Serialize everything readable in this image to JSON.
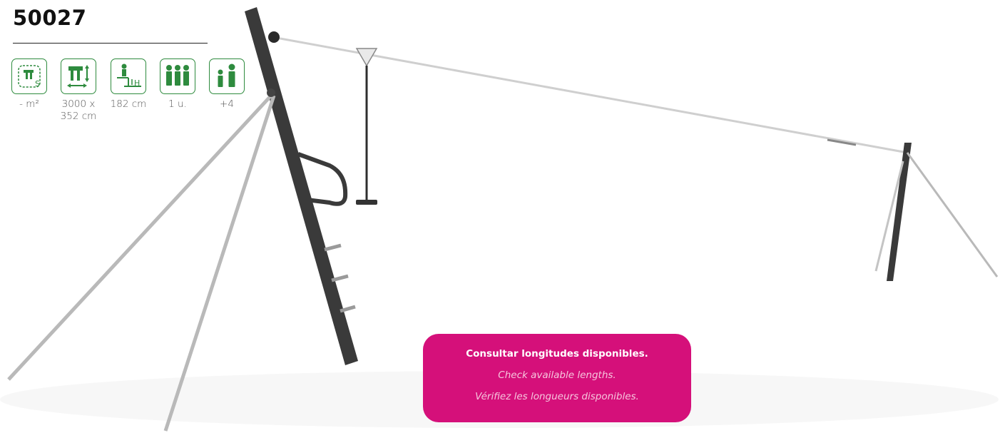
{
  "product": {
    "code": "50027"
  },
  "specs": [
    {
      "icon": "safety-area-icon",
      "value": "- m²"
    },
    {
      "icon": "dimensions-icon",
      "value": "3000 x\n352 cm"
    },
    {
      "icon": "fall-height-icon",
      "value": "182 cm"
    },
    {
      "icon": "units-icon",
      "value": "1 u."
    },
    {
      "icon": "age-icon",
      "value": "+4"
    }
  ],
  "notice": {
    "es": "Consultar longitudes disponibles.",
    "en": "Check available lengths.",
    "fr": "Vérifiez les longueurs disponibles."
  },
  "colors": {
    "accent": "#2e8b3e",
    "notice_bg": "#d5107a",
    "frame": "#3a3a3a",
    "steel": "#b9b9b9"
  }
}
